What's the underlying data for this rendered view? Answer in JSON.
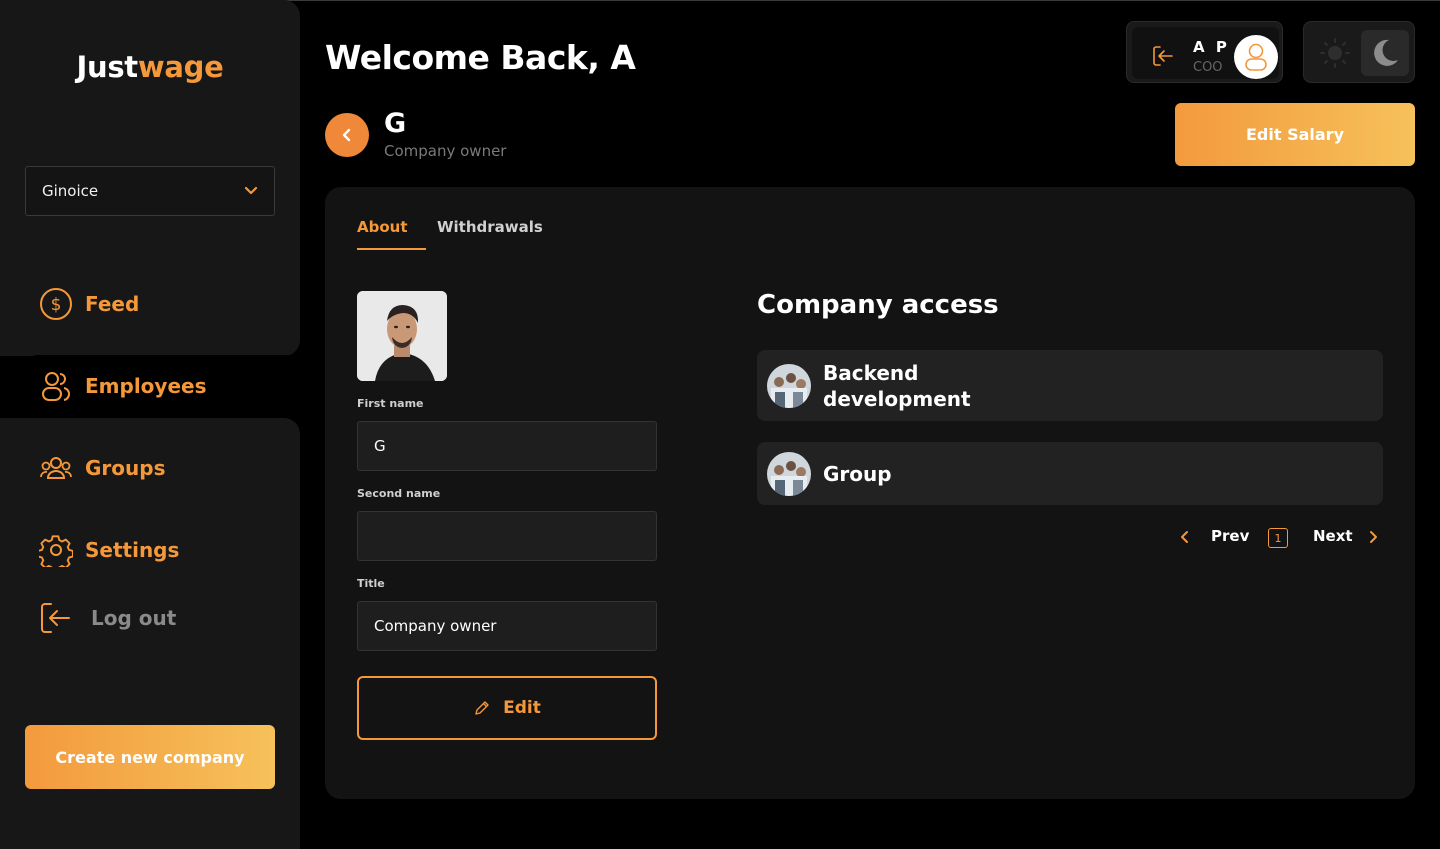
{
  "app": {
    "logo_part1": "Just",
    "logo_part2": "wage",
    "accent_color": "#f4983a"
  },
  "sidebar": {
    "company_select": {
      "value": "Ginoice"
    },
    "items": [
      {
        "label": "Feed",
        "icon": "dollar-circle-icon"
      },
      {
        "label": "Employees",
        "icon": "users-icon",
        "active": true
      },
      {
        "label": "Groups",
        "icon": "group-icon"
      },
      {
        "label": "Settings",
        "icon": "gear-icon"
      },
      {
        "label": "Log out",
        "icon": "logout-icon"
      }
    ],
    "create_button": "Create new company"
  },
  "header": {
    "welcome": "Welcome Back, A",
    "user": {
      "initials": "A P",
      "role": "COO"
    },
    "theme": {
      "options": [
        "light",
        "dark"
      ],
      "selected": "dark"
    }
  },
  "employee": {
    "name": "G",
    "title": "Company owner",
    "edit_salary_label": "Edit Salary"
  },
  "tabs": [
    {
      "label": "About",
      "active": true
    },
    {
      "label": "Withdrawals",
      "active": false
    }
  ],
  "form": {
    "first_name": {
      "label": "First name",
      "value": "G"
    },
    "second_name": {
      "label": "Second name",
      "value": ""
    },
    "title": {
      "label": "Title",
      "value": "Company owner"
    },
    "edit_label": "Edit"
  },
  "company_access": {
    "heading": "Company access",
    "groups": [
      {
        "name": "Backend development"
      },
      {
        "name": "Group"
      }
    ],
    "pagination": {
      "prev": "Prev",
      "current": "1",
      "next": "Next"
    }
  }
}
